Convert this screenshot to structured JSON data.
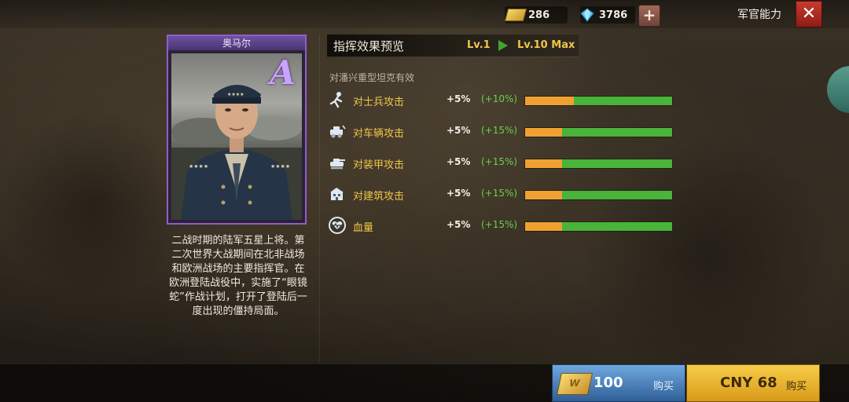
{
  "topbar": {
    "gold": "286",
    "diamonds": "3786",
    "plus_symbol": "+",
    "title": "军官能力",
    "close_symbol": "✕"
  },
  "card": {
    "name": "奥马尔",
    "rank": "A",
    "description": "二战时期的陆军五星上将。第二次世界大战期间在北非战场和欧洲战场的主要指挥官。在欧洲登陆战役中，实施了“眼镜蛇”作战计划，打开了登陆后一度出现的僵持局面。"
  },
  "preview": {
    "title": "指挥效果预览",
    "level_from": "Lv.1",
    "level_to": "Lv.10 Max",
    "note": "对潘兴重型坦克有效"
  },
  "stats": [
    {
      "label": "对士兵攻击",
      "base": "+5%",
      "bonus": "(+10%)",
      "icon": "soldier-icon",
      "fill_percent": 33
    },
    {
      "label": "对车辆攻击",
      "base": "+5%",
      "bonus": "(+15%)",
      "icon": "vehicle-icon",
      "fill_percent": 25
    },
    {
      "label": "对装甲攻击",
      "base": "+5%",
      "bonus": "(+15%)",
      "icon": "armor-icon",
      "fill_percent": 25
    },
    {
      "label": "对建筑攻击",
      "base": "+5%",
      "bonus": "(+15%)",
      "icon": "building-icon",
      "fill_percent": 25
    },
    {
      "label": "血量",
      "base": "+5%",
      "bonus": "(+15%)",
      "icon": "heart-icon",
      "fill_percent": 25
    }
  ],
  "purchase": {
    "gold_coin_letter": "W",
    "gold_amount": "100",
    "gold_buy_label": "购买",
    "cny_amount": "CNY 68",
    "cny_buy_label": "购买"
  },
  "colors": {
    "gold_text": "#f0c64a",
    "bonus_green": "#6ad04a",
    "bar_orange": "#f0a030",
    "bar_green": "#4ab33a",
    "card_border": "#8e5fc8"
  }
}
